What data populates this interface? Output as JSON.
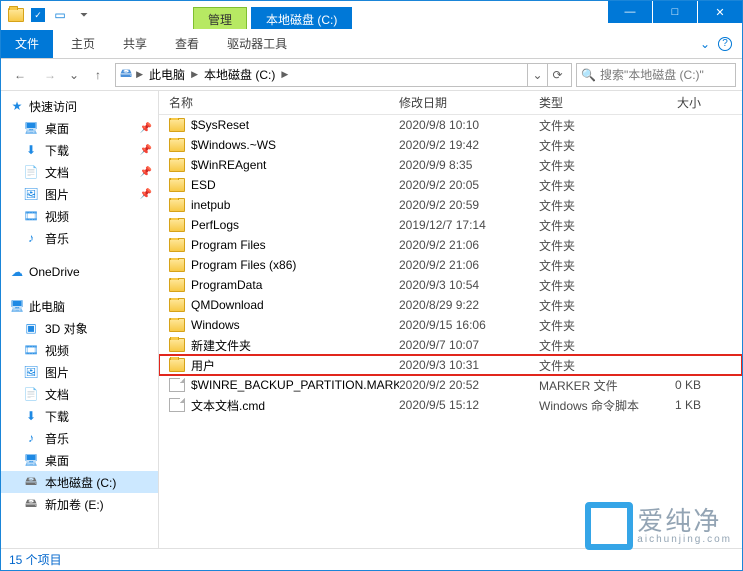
{
  "titlebar": {
    "tab_manage": "管理",
    "tab_location": "本地磁盘 (C:)",
    "min": "—",
    "max": "□",
    "close": "✕"
  },
  "ribbon": {
    "file": "文件",
    "tabs": [
      "主页",
      "共享",
      "查看",
      "驱动器工具"
    ],
    "help_icon": "?",
    "expand_icon": "⌄"
  },
  "address": {
    "back": "←",
    "forward": "→",
    "recent": "⌄",
    "up": "↑",
    "crumbs": [
      "此电脑",
      "本地磁盘 (C:)"
    ],
    "dropdown": "⌄",
    "refresh": "⟳",
    "search_placeholder": "搜索\"本地磁盘 (C:)\"",
    "search_icon": "🔍"
  },
  "nav": {
    "quick": {
      "label": "快速访问",
      "items": [
        {
          "label": "桌面",
          "pinned": true
        },
        {
          "label": "下载",
          "pinned": true
        },
        {
          "label": "文档",
          "pinned": true
        },
        {
          "label": "图片",
          "pinned": true
        },
        {
          "label": "视频",
          "pinned": false
        },
        {
          "label": "音乐",
          "pinned": false
        }
      ]
    },
    "onedrive": "OneDrive",
    "thispc": {
      "label": "此电脑",
      "items": [
        {
          "label": "3D 对象"
        },
        {
          "label": "视频"
        },
        {
          "label": "图片"
        },
        {
          "label": "文档"
        },
        {
          "label": "下载"
        },
        {
          "label": "音乐"
        },
        {
          "label": "桌面"
        },
        {
          "label": "本地磁盘 (C:)",
          "selected": true
        },
        {
          "label": "新加卷 (E:)"
        }
      ]
    }
  },
  "columns": {
    "name": "名称",
    "date": "修改日期",
    "type": "类型",
    "size": "大小"
  },
  "files": [
    {
      "icon": "folder",
      "name": "$SysReset",
      "date": "2020/9/8 10:10",
      "type": "文件夹",
      "size": ""
    },
    {
      "icon": "folder",
      "name": "$Windows.~WS",
      "date": "2020/9/2 19:42",
      "type": "文件夹",
      "size": ""
    },
    {
      "icon": "folder",
      "name": "$WinREAgent",
      "date": "2020/9/9 8:35",
      "type": "文件夹",
      "size": ""
    },
    {
      "icon": "folder",
      "name": "ESD",
      "date": "2020/9/2 20:05",
      "type": "文件夹",
      "size": ""
    },
    {
      "icon": "folder",
      "name": "inetpub",
      "date": "2020/9/2 20:59",
      "type": "文件夹",
      "size": ""
    },
    {
      "icon": "folder",
      "name": "PerfLogs",
      "date": "2019/12/7 17:14",
      "type": "文件夹",
      "size": ""
    },
    {
      "icon": "folder",
      "name": "Program Files",
      "date": "2020/9/2 21:06",
      "type": "文件夹",
      "size": ""
    },
    {
      "icon": "folder",
      "name": "Program Files (x86)",
      "date": "2020/9/2 21:06",
      "type": "文件夹",
      "size": ""
    },
    {
      "icon": "folder",
      "name": "ProgramData",
      "date": "2020/9/3 10:54",
      "type": "文件夹",
      "size": ""
    },
    {
      "icon": "folder",
      "name": "QMDownload",
      "date": "2020/8/29 9:22",
      "type": "文件夹",
      "size": ""
    },
    {
      "icon": "folder",
      "name": "Windows",
      "date": "2020/9/15 16:06",
      "type": "文件夹",
      "size": ""
    },
    {
      "icon": "folder",
      "name": "新建文件夹",
      "date": "2020/9/7 10:07",
      "type": "文件夹",
      "size": ""
    },
    {
      "icon": "folder",
      "name": "用户",
      "date": "2020/9/3 10:31",
      "type": "文件夹",
      "size": "",
      "highlighted": true
    },
    {
      "icon": "file",
      "name": "$WINRE_BACKUP_PARTITION.MARKER",
      "date": "2020/9/2 20:52",
      "type": "MARKER 文件",
      "size": "0 KB"
    },
    {
      "icon": "file",
      "name": "文本文档.cmd",
      "date": "2020/9/5 15:12",
      "type": "Windows 命令脚本",
      "size": "1 KB"
    }
  ],
  "status": {
    "item_count": "15 个项目"
  },
  "watermark": {
    "text": "爱纯净",
    "sub": "aichunjing.com"
  }
}
